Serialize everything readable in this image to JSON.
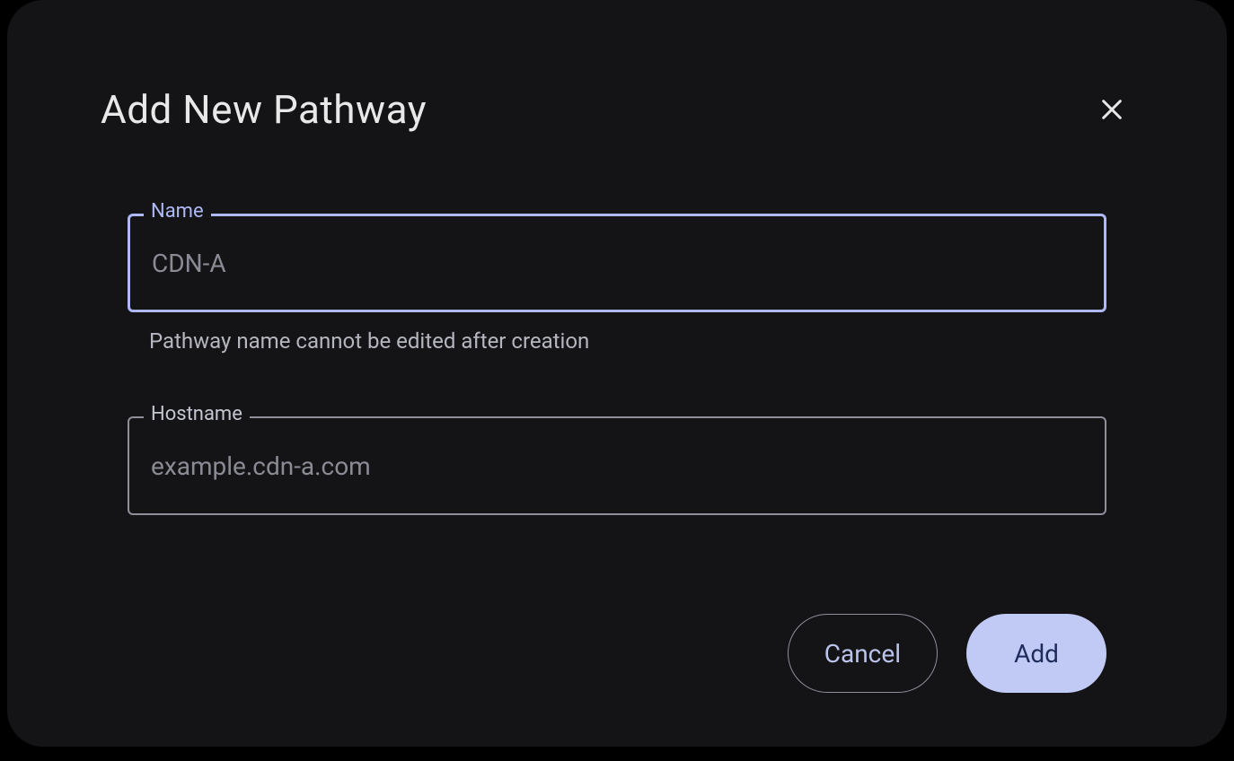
{
  "dialog": {
    "title": "Add New Pathway",
    "fields": {
      "name": {
        "label": "Name",
        "placeholder": "CDN-A",
        "value": "",
        "helper": "Pathway name cannot be edited after creation"
      },
      "hostname": {
        "label": "Hostname",
        "placeholder": "example.cdn-a.com",
        "value": ""
      }
    },
    "buttons": {
      "cancel": "Cancel",
      "add": "Add"
    }
  }
}
